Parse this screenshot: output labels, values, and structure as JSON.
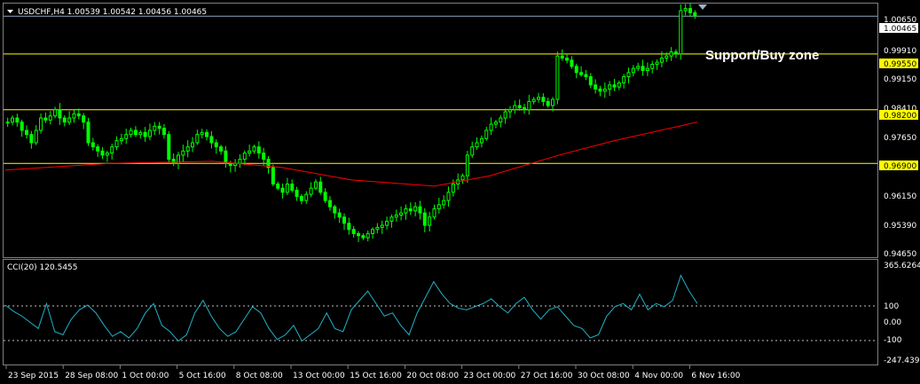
{
  "header": {
    "symbol_info": "USDCHF,H4  1.00539 1.00542 1.00456 1.00465",
    "annotation": "Support/Buy zone"
  },
  "price_axis": {
    "ticks": [
      "1.00650",
      "0.99910",
      "0.99150",
      "0.98410",
      "0.97650",
      "0.96150",
      "0.95390",
      "0.94650"
    ],
    "current_price": "1.00465",
    "levels": [
      "0.99550",
      "0.98200",
      "0.96900"
    ]
  },
  "cci": {
    "title": "CCI(20) 120.5455",
    "ticks": [
      "365.6264",
      "100",
      "0.00",
      "-100",
      "-247.4391"
    ]
  },
  "time_axis": {
    "labels": [
      "23 Sep 2015",
      "28 Sep 08:00",
      "1 Oct 00:00",
      "5 Oct 16:00",
      "8 Oct 08:00",
      "13 Oct 00:00",
      "15 Oct 16:00",
      "20 Oct 08:00",
      "23 Oct 00:00",
      "27 Oct 16:00",
      "30 Oct 08:00",
      "4 Nov 00:00",
      "6 Nov 16:00"
    ]
  },
  "colors": {
    "background": "#000000",
    "candle": "#00ff00",
    "moving_average": "#ff0000",
    "level_line": "#ffff00",
    "level_label_bg": "#ffff00",
    "current_line": "#8fa7c4",
    "cci_line": "#20b2c8",
    "grid_dotted": "#c0c0c0",
    "panel_border": "#808080"
  },
  "chart_data": {
    "type": "candlestick",
    "symbol": "USDCHF",
    "timeframe": "H4",
    "close_path": [
      0.979,
      0.98,
      0.979,
      0.977,
      0.976,
      0.974,
      0.977,
      0.98,
      0.9795,
      0.9805,
      0.982,
      0.98,
      0.979,
      0.98,
      0.981,
      0.9805,
      0.979,
      0.974,
      0.973,
      0.972,
      0.971,
      0.9715,
      0.973,
      0.9745,
      0.975,
      0.976,
      0.977,
      0.976,
      0.9765,
      0.9755,
      0.977,
      0.978,
      0.9775,
      0.976,
      0.97,
      0.969,
      0.971,
      0.972,
      0.973,
      0.974,
      0.976,
      0.9765,
      0.9755,
      0.974,
      0.973,
      0.972,
      0.969,
      0.9685,
      0.969,
      0.97,
      0.9715,
      0.972,
      0.973,
      0.9715,
      0.97,
      0.968,
      0.964,
      0.963,
      0.962,
      0.964,
      0.9625,
      0.961,
      0.96,
      0.9615,
      0.963,
      0.9645,
      0.962,
      0.96,
      0.9585,
      0.957,
      0.956,
      0.9545,
      0.953,
      0.952,
      0.9515,
      0.951,
      0.952,
      0.953,
      0.9535,
      0.954,
      0.955,
      0.956,
      0.9565,
      0.957,
      0.958,
      0.9575,
      0.9585,
      0.957,
      0.954,
      0.956,
      0.958,
      0.959,
      0.96,
      0.962,
      0.964,
      0.965,
      0.966,
      0.971,
      0.973,
      0.974,
      0.975,
      0.977,
      0.9785,
      0.979,
      0.98,
      0.9815,
      0.982,
      0.983,
      0.9825,
      0.982,
      0.984,
      0.9845,
      0.985,
      0.984,
      0.983,
      0.9845,
      0.995,
      0.9945,
      0.994,
      0.9925,
      0.991,
      0.9905,
      0.99,
      0.988,
      0.987,
      0.9865,
      0.987,
      0.988,
      0.9875,
      0.9885,
      0.99,
      0.991,
      0.992,
      0.9925,
      0.9915,
      0.992,
      0.993,
      0.9935,
      0.9945,
      0.995,
      0.996,
      0.9955,
      1.006,
      1.0065,
      1.0055,
      1.0047
    ],
    "moving_average": [
      [
        0.0,
        0.9674
      ],
      [
        0.15,
        0.969
      ],
      [
        0.3,
        0.9695
      ],
      [
        0.4,
        0.968
      ],
      [
        0.5,
        0.965
      ],
      [
        0.62,
        0.9635
      ],
      [
        0.7,
        0.966
      ],
      [
        0.8,
        0.971
      ],
      [
        0.88,
        0.9745
      ],
      [
        1.0,
        0.979
      ]
    ],
    "horizontal_levels": [
      0.9955,
      0.982,
      0.969
    ],
    "current_price": 1.00465,
    "price_range": [
      0.9465,
      1.0075
    ],
    "cci_values": [
      110,
      70,
      40,
      0,
      -40,
      120,
      -60,
      -80,
      20,
      80,
      110,
      60,
      -20,
      -90,
      -60,
      -100,
      -40,
      60,
      120,
      -20,
      -60,
      -120,
      -80,
      60,
      140,
      40,
      -40,
      -90,
      -60,
      20,
      100,
      60,
      -40,
      -110,
      -80,
      -20,
      -120,
      -80,
      -40,
      60,
      -40,
      -60,
      80,
      140,
      200,
      120,
      40,
      60,
      -20,
      -80,
      60,
      160,
      260,
      180,
      120,
      90,
      80,
      100,
      120,
      150,
      100,
      60,
      120,
      160,
      80,
      20,
      80,
      100,
      40,
      -20,
      -40,
      -100,
      -80,
      40,
      100,
      120,
      80,
      180,
      80,
      120,
      100,
      140,
      300,
      200,
      120
    ],
    "cci_range": [
      -247.4391,
      365.6264
    ]
  }
}
